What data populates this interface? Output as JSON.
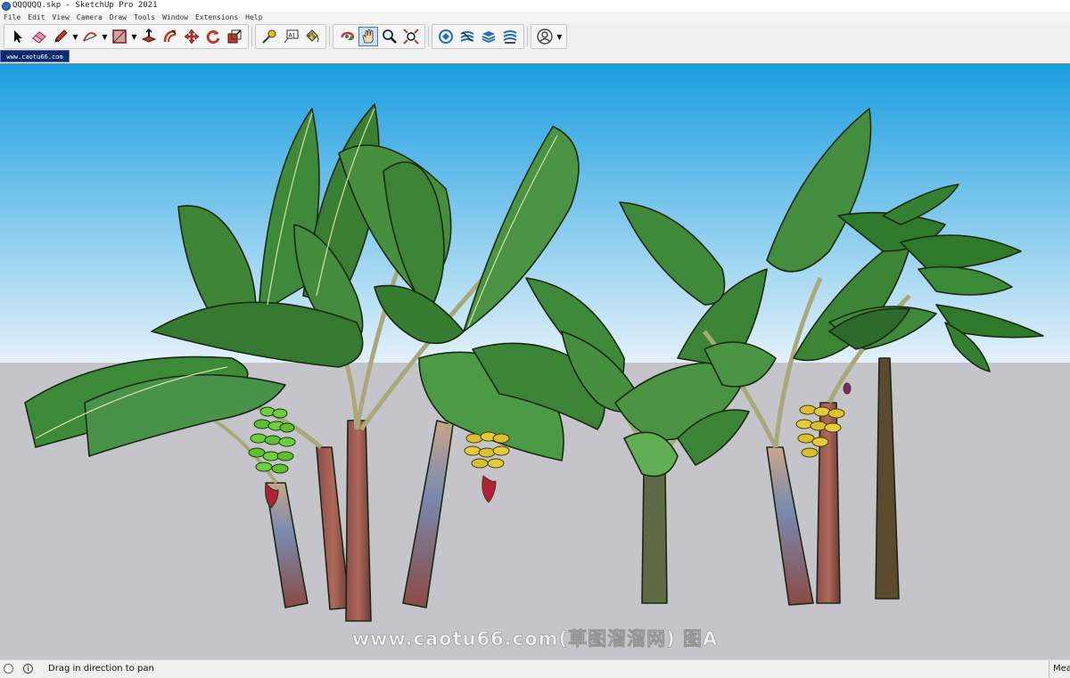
{
  "window": {
    "title": "QQQQQQ.skp - SketchUp Pro 2021"
  },
  "menu": {
    "items": [
      "File",
      "Edit",
      "View",
      "Camera",
      "Draw",
      "Tools",
      "Window",
      "Extensions",
      "Help"
    ]
  },
  "toolbar": {
    "tools": [
      {
        "name": "select-tool",
        "icon": "arrow-cursor-icon"
      },
      {
        "name": "eraser-tool",
        "icon": "eraser-icon"
      },
      {
        "name": "line-tool",
        "icon": "pencil-icon"
      },
      {
        "name": "arc-tool",
        "icon": "arc-icon"
      },
      {
        "name": "rectangle-tool",
        "icon": "rectangle-icon"
      },
      {
        "name": "push-pull-tool",
        "icon": "push-pull-icon"
      },
      {
        "name": "offset-tool",
        "icon": "offset-icon"
      },
      {
        "name": "move-tool",
        "icon": "move-arrows-icon"
      },
      {
        "name": "rotate-tool",
        "icon": "rotate-icon"
      },
      {
        "name": "scale-tool",
        "icon": "scale-icon"
      },
      {
        "name": "tape-measure-tool",
        "icon": "tape-measure-icon"
      },
      {
        "name": "text-tool",
        "icon": "text-label-icon"
      },
      {
        "name": "paint-bucket-tool",
        "icon": "paint-bucket-icon"
      },
      {
        "name": "orbit-tool",
        "icon": "orbit-icon"
      },
      {
        "name": "pan-tool",
        "icon": "pan-hand-icon"
      },
      {
        "name": "zoom-tool",
        "icon": "zoom-magnifier-icon"
      },
      {
        "name": "zoom-extents-tool",
        "icon": "zoom-extents-icon"
      },
      {
        "name": "warehouse-tool",
        "icon": "3d-warehouse-icon"
      },
      {
        "name": "extension-warehouse-tool",
        "icon": "extension-warehouse-icon"
      },
      {
        "name": "layout-tool",
        "icon": "layout-icon"
      },
      {
        "name": "extension-manager-tool",
        "icon": "extension-manager-icon"
      },
      {
        "name": "account-tool",
        "icon": "user-account-icon"
      }
    ],
    "active_tool": "pan-tool",
    "text_tool_glyph": "A1"
  },
  "scene_tabs": [
    {
      "label": "www.caotu66.com",
      "active": true
    }
  ],
  "viewport": {
    "sky_top": "#1a9ee0",
    "sky_bottom": "#e3f1fa",
    "ground": "#c4c4ca",
    "watermark": "www.caotu66.com(草图溜溜网) 图A"
  },
  "status": {
    "message": "Drag in direction to pan",
    "measurements_label": "Measurements",
    "info_glyph": "i"
  },
  "colors": {
    "accent": "#3b7bd0",
    "scene_tab": "#0d2a6e"
  }
}
